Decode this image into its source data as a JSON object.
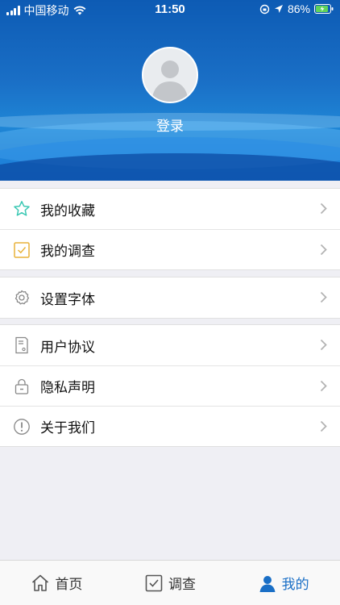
{
  "status_bar": {
    "carrier": "中国移动",
    "time": "11:50",
    "battery": "86%"
  },
  "profile": {
    "login_label": "登录"
  },
  "menu_groups": [
    [
      {
        "label": "我的收藏",
        "icon": "star-icon"
      },
      {
        "label": "我的调查",
        "icon": "checkbox-icon"
      }
    ],
    [
      {
        "label": "设置字体",
        "icon": "gear-icon"
      }
    ],
    [
      {
        "label": "用户协议",
        "icon": "document-icon"
      },
      {
        "label": "隐私声明",
        "icon": "lock-icon"
      },
      {
        "label": "关于我们",
        "icon": "info-icon"
      }
    ]
  ],
  "tabs": [
    {
      "label": "首页",
      "icon": "home-icon",
      "active": false
    },
    {
      "label": "调查",
      "icon": "survey-icon",
      "active": false
    },
    {
      "label": "我的",
      "icon": "user-icon",
      "active": true
    }
  ],
  "colors": {
    "accent": "#1a6fc6",
    "star": "#3cc8b4",
    "survey_icon": "#e8b23a"
  }
}
